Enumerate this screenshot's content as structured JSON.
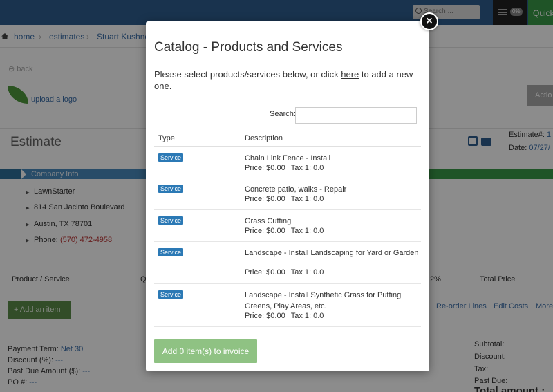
{
  "header": {
    "search_placeholder": "Search ...",
    "notif_pct": "0%",
    "quick_label": "Quick"
  },
  "breadcrumb": [
    "home",
    "estimates",
    "Stuart Kushner"
  ],
  "page": {
    "back_label": "back",
    "upload_logo": "upload a logo",
    "actions_label": "Actio",
    "estimate_title": "Estimate",
    "estimate_num_label": "Estimate#:",
    "estimate_num_val": "1",
    "date_label": "Date:",
    "date_val": "07/27/",
    "company_info_label": "Company Info",
    "company": {
      "name": "LawnStarter",
      "street": "814 San Jacinto Boulevard",
      "city": "Austin, TX  78701",
      "phone_label": "Phone:",
      "phone": "(570) 472-4958"
    },
    "table_headers": {
      "product": "Product / Service",
      "q": "Q",
      "pct": "2%",
      "total": "Total Price"
    },
    "add_item_label": "+ Add an item",
    "links": {
      "reorder": "Re-order Lines",
      "edit_costs": "Edit Costs",
      "more": "More"
    },
    "footer_left": [
      {
        "label": "Payment Term:",
        "value": "Net 30"
      },
      {
        "label": "Discount (%):",
        "value": "---"
      },
      {
        "label": "Past Due Amount ($):",
        "value": "---"
      },
      {
        "label": "PO #:",
        "value": "---"
      }
    ],
    "footer_right": [
      "Subtotal:",
      "Discount:",
      "Tax:",
      "Past Due:"
    ],
    "total_label": "Total amount :"
  },
  "modal": {
    "close_glyph": "×",
    "title": "Catalog - Products and Services",
    "intro_before": "Please select products/services below, or click ",
    "intro_link": "here",
    "intro_after": " to add a new one.",
    "search_label": "Search:",
    "search_value": "",
    "col_type": "Type",
    "col_description": "Description",
    "items": [
      {
        "type": "Service",
        "description": "Chain Link Fence - Install",
        "price": "Price: $0.00",
        "tax": "Tax 1: 0.0"
      },
      {
        "type": "Service",
        "description": "Concrete patio, walks - Repair",
        "price": "Price: $0.00",
        "tax": "Tax 1: 0.0"
      },
      {
        "type": "Service",
        "description": "Grass Cutting",
        "price": "Price: $0.00",
        "tax": "Tax 1: 0.0"
      },
      {
        "type": "Service",
        "description": "Landscape - Install Landscaping for Yard or Garden",
        "price": "Price: $0.00",
        "tax": "Tax 1: 0.0"
      },
      {
        "type": "Service",
        "description": "Landscape - Install Synthetic Grass for Putting Greens, Play Areas, etc.",
        "price": "Price: $0.00",
        "tax": "Tax 1: 0.0"
      }
    ],
    "add_button": "Add 0 item(s) to invoice"
  }
}
